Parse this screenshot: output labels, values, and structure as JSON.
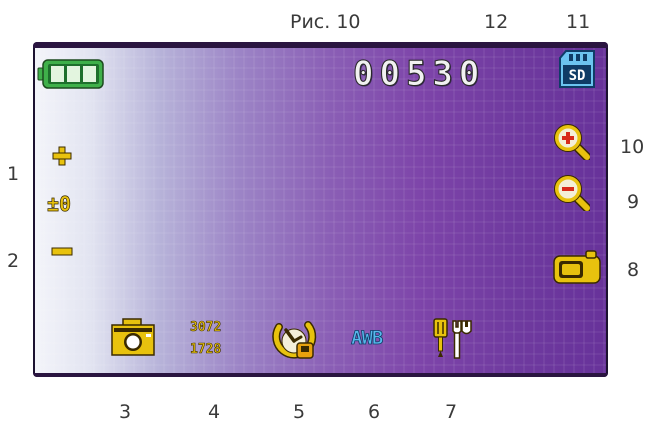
{
  "figure_caption": "Рис. 10",
  "callouts": {
    "n1": "1",
    "n2": "2",
    "n3": "3",
    "n4": "4",
    "n5": "5",
    "n6": "6",
    "n7": "7",
    "n8": "8",
    "n9": "9",
    "n10": "10",
    "n11": "11",
    "n12": "12"
  },
  "screen": {
    "shot_counter": "00530",
    "resolution_top": "3072",
    "resolution_bottom": "1728",
    "ev_value": "±0",
    "white_balance": "AWB",
    "storage_label": "SD"
  },
  "icons": {
    "battery": "battery-full-icon",
    "sd_card": "sd-card-icon",
    "ev_plus": "plus-icon",
    "ev_minus": "minus-icon",
    "zoom_in": "zoom-in-icon",
    "zoom_out": "zoom-out-icon",
    "mode": "camera-mode-icon",
    "capture": "photo-camera-icon",
    "self_timer": "self-timer-icon",
    "settings": "settings-tools-icon"
  },
  "colors": {
    "icon_yellow": "#e8c20e",
    "battery_green": "#3fb04a",
    "awb_blue": "#58b8ec",
    "zoom_red": "#d82a1a"
  }
}
